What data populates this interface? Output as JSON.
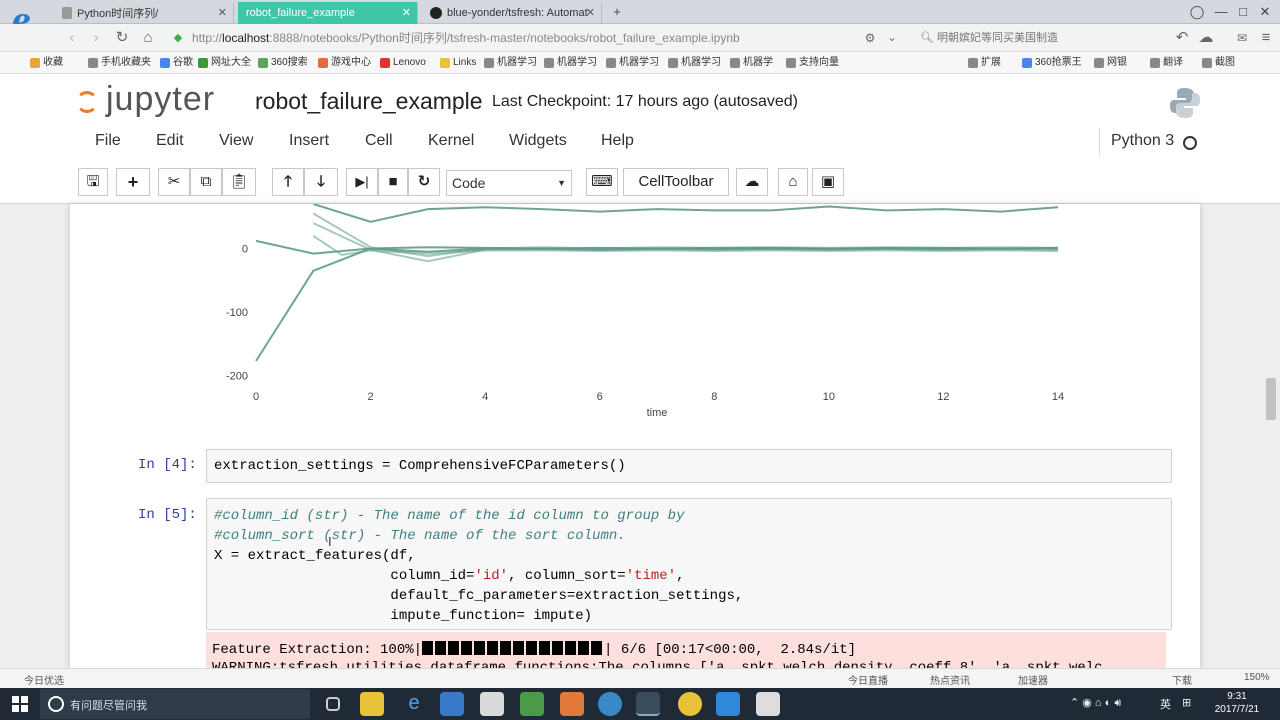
{
  "browser": {
    "tabs": [
      {
        "label": "Python时间序列/",
        "active": false
      },
      {
        "label": "robot_failure_example",
        "active": true
      },
      {
        "label": "blue-yonder/tsfresh: Automat",
        "active": false
      }
    ],
    "new_tab": "+",
    "url_prefix": "http://",
    "url_host": "localhost",
    "url_path": ":8888/notebooks/Python时间序列/tsfresh-master/notebooks/robot_failure_example.ipynb",
    "search_text": "明朝嫔妃等同买美国制造",
    "bookmarks": [
      "收藏",
      "手机收藏夹",
      "谷歌",
      "网址大全",
      "360搜索",
      "游戏中心",
      "Lenovo",
      "Links",
      "机器学习",
      "机器学习",
      "机器学习",
      "机器学习",
      "机器学",
      "支持向量"
    ],
    "right_bookmarks": [
      "扩展",
      "360抢票王",
      "网银",
      "翻译",
      "截图"
    ]
  },
  "jupyter": {
    "logo_text": "jupyter",
    "notebook_name": "robot_failure_example",
    "checkpoint": "Last Checkpoint: 17 hours ago (autosaved)",
    "menu": [
      "File",
      "Edit",
      "View",
      "Insert",
      "Cell",
      "Kernel",
      "Widgets",
      "Help"
    ],
    "kernel": "Python 3",
    "cell_type": "Code",
    "celltoolbar": "CellToolbar"
  },
  "chart_data": {
    "type": "line",
    "xlabel": "time",
    "x_ticks": [
      0,
      2,
      4,
      6,
      8,
      10,
      12,
      14
    ],
    "y_ticks": [
      0,
      -100,
      -200
    ],
    "ylim": [
      -210,
      70
    ],
    "xlim": [
      0,
      14
    ],
    "color": "#5f9a8a",
    "series": [
      {
        "values": [
          [
            1,
            70
          ],
          [
            2,
            42
          ],
          [
            3,
            62
          ],
          [
            4,
            65
          ],
          [
            5,
            62
          ],
          [
            6,
            58
          ],
          [
            7,
            62
          ],
          [
            8,
            60
          ],
          [
            9,
            60
          ],
          [
            10,
            66
          ],
          [
            11,
            60
          ],
          [
            12,
            62
          ],
          [
            13,
            58
          ],
          [
            14,
            65
          ]
        ]
      },
      {
        "values": [
          [
            0,
            -177
          ],
          [
            1,
            -35
          ],
          [
            2,
            0
          ],
          [
            3,
            -5
          ],
          [
            4,
            0
          ],
          [
            5,
            0
          ],
          [
            6,
            -2
          ],
          [
            7,
            0
          ],
          [
            8,
            -1
          ],
          [
            9,
            0
          ],
          [
            10,
            -1
          ],
          [
            11,
            0
          ],
          [
            12,
            -1
          ],
          [
            13,
            0
          ],
          [
            14,
            0
          ]
        ]
      },
      {
        "values": [
          [
            0,
            12
          ],
          [
            1,
            -8
          ],
          [
            2,
            0
          ],
          [
            3,
            2
          ],
          [
            4,
            1
          ],
          [
            5,
            0
          ],
          [
            6,
            1
          ],
          [
            7,
            0
          ],
          [
            8,
            1
          ],
          [
            9,
            1
          ],
          [
            10,
            0
          ],
          [
            11,
            1
          ],
          [
            12,
            1
          ],
          [
            13,
            0
          ],
          [
            14,
            1
          ]
        ]
      },
      {
        "values": [
          [
            1,
            40
          ],
          [
            2,
            -2
          ],
          [
            3,
            -20
          ],
          [
            4,
            -2
          ],
          [
            5,
            -1
          ],
          [
            6,
            -2
          ],
          [
            7,
            -1
          ],
          [
            8,
            -2
          ],
          [
            9,
            -1
          ],
          [
            10,
            -2
          ],
          [
            11,
            -1
          ],
          [
            12,
            -2
          ],
          [
            13,
            -1
          ],
          [
            14,
            -2
          ]
        ]
      },
      {
        "values": [
          [
            1,
            20
          ],
          [
            1.5,
            -10
          ],
          [
            2,
            -3
          ],
          [
            3,
            -8
          ],
          [
            4,
            -3
          ],
          [
            5,
            -3
          ],
          [
            6,
            -4
          ],
          [
            7,
            -3
          ],
          [
            8,
            -4
          ],
          [
            9,
            -3
          ],
          [
            10,
            -4
          ],
          [
            11,
            -3
          ],
          [
            12,
            -4
          ],
          [
            13,
            -3
          ],
          [
            14,
            -4
          ]
        ]
      },
      {
        "values": [
          [
            1,
            55
          ],
          [
            2,
            2
          ],
          [
            3,
            -12
          ],
          [
            4,
            0
          ],
          [
            5,
            2
          ],
          [
            6,
            0
          ],
          [
            7,
            2
          ],
          [
            8,
            1
          ],
          [
            9,
            2
          ],
          [
            10,
            1
          ],
          [
            11,
            2
          ],
          [
            12,
            1
          ],
          [
            13,
            2
          ],
          [
            14,
            1
          ]
        ]
      }
    ]
  },
  "cells": [
    {
      "prompt": "In [4]:",
      "lines": [
        "extraction_settings = ComprehensiveFCParameters()"
      ]
    },
    {
      "prompt": "In [5]:",
      "comment1": "#column_id (str) - The name of the id column to group by",
      "comment2": "#column_sort (str) - The name of the sort column.",
      "line3": "X = extract_features(df,",
      "line4_a": "                     column_id=",
      "line4_s1": "'id'",
      "line4_b": ", column_sort=",
      "line4_s2": "'time'",
      "line4_c": ",",
      "line5": "                     default_fc_parameters=extraction_settings,",
      "line6": "                     impute_function= impute)"
    }
  ],
  "output": {
    "progress_label": "Feature Extraction: 100%|",
    "progress_stats": "| 6/6 [00:17<00:00,  2.84s/it]",
    "warning": "WARNING:tsfresh.utilities.dataframe_functions:The columns ['a__spkt_welch_density__coeff_8', 'a__spkt_welc"
  },
  "statusbar": {
    "left": "今日优选",
    "items": [
      "今日直播",
      "热点资讯",
      "加速器",
      "下载",
      "150%"
    ]
  },
  "taskbar": {
    "search_placeholder": "有问题尽管问我",
    "time": "9:31",
    "date": "2017/7/21",
    "ime": "英"
  }
}
